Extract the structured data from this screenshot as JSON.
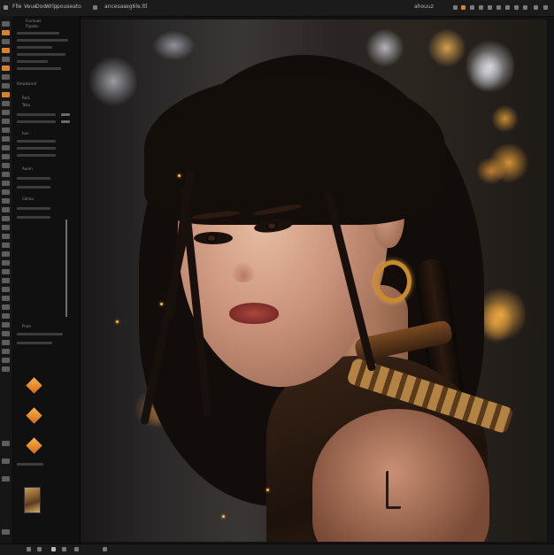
{
  "menubar": {
    "items": [
      "Flle",
      "Veue",
      "Ooo",
      "Wrlp",
      "pouseato",
      "ancesas",
      "eg6le.ltl",
      "ahouuz"
    ]
  },
  "panel": {
    "rows": [
      "Frumuwr",
      "Ftpalac",
      "RorL",
      "Tobu",
      "hun",
      "Auron",
      "Cdirou",
      "Pnoe"
    ],
    "section_label": "Kmwlsarnd"
  },
  "colors": {
    "accent": "#d9822b",
    "keyframe": "#f0a03c",
    "panel_bg": "#101010",
    "menubar_bg": "#1b1b1b"
  },
  "canvas": {
    "image_subject": "portrait"
  }
}
